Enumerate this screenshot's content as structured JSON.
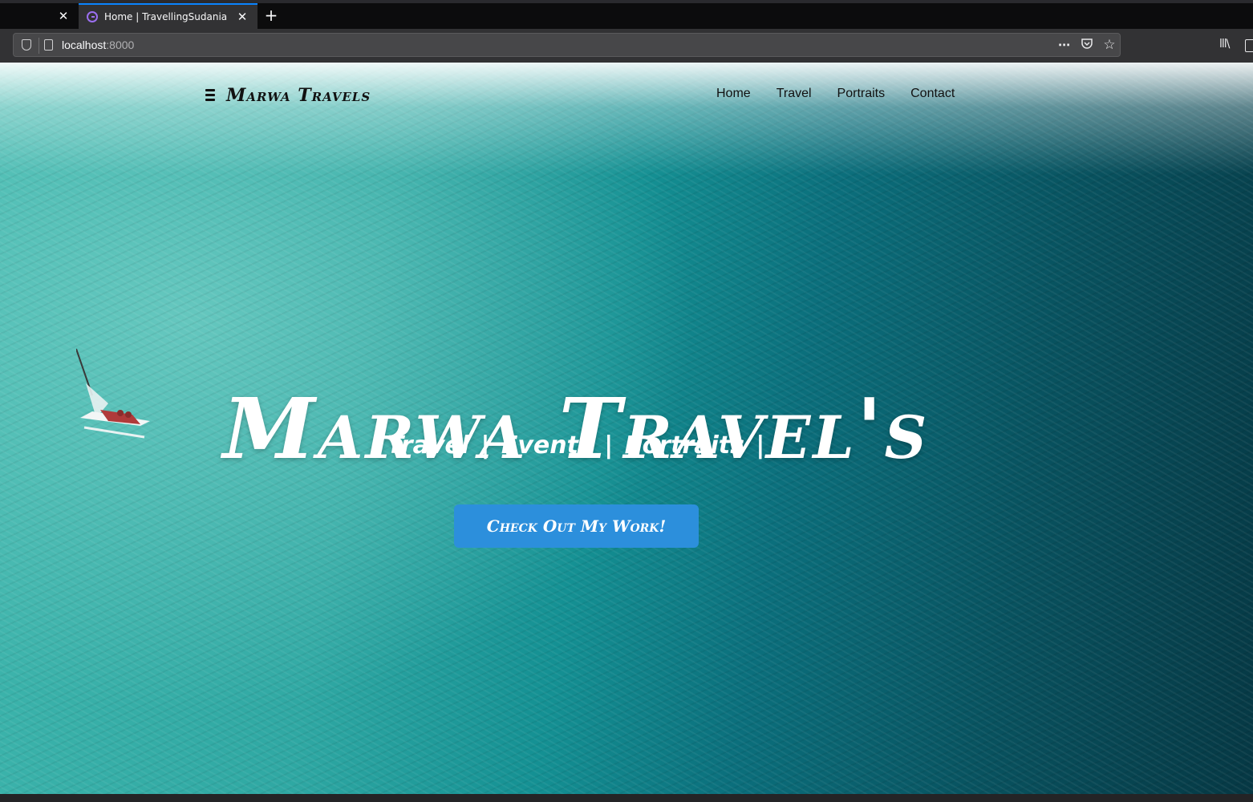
{
  "browser": {
    "tabs": [
      {
        "title": "",
        "active": false
      },
      {
        "title": "Home | TravellingSudania",
        "active": true
      }
    ],
    "new_tab_symbol": "+",
    "close_symbol": "✕",
    "url": {
      "host": "localhost",
      "port": ":8000"
    },
    "icons": {
      "more": "⋯",
      "pocket": "◇",
      "star": "☆",
      "library": "lll\\"
    }
  },
  "site": {
    "brand": "Marwa Travels",
    "nav": [
      "Home",
      "Travel",
      "Portraits",
      "Contact"
    ],
    "hero": {
      "title": "Marwa Travel's",
      "subtitle": "Travel |  Events |  Portraits |",
      "cta_label": "Check Out My Work!"
    }
  },
  "colors": {
    "accent": "#2c8fdc",
    "tab_highlight": "#0a84ff",
    "ocean_light": "#3fb6ad",
    "ocean_dark": "#063844"
  }
}
